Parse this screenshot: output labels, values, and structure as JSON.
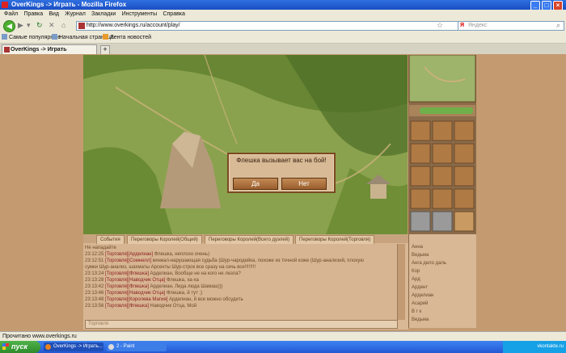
{
  "window": {
    "title": "OverKings -> Играть - Mozilla Firefox"
  },
  "menu": [
    "Файл",
    "Правка",
    "Вид",
    "Журнал",
    "Закладки",
    "Инструменты",
    "Справка"
  ],
  "nav": {
    "url": "http://www.overkings.ru/account/play/",
    "search_placeholder": "Яндекс",
    "search_logo": "Я"
  },
  "bookmarks": [
    "Самые популярные",
    "Начальная страница",
    "Лента новостей"
  ],
  "tab": {
    "label": "OverKings -> Играть",
    "new_tab": "+"
  },
  "popup": {
    "message": "Флешка вызывает вас на бой!",
    "yes": "Да",
    "no": "Нет"
  },
  "chat": {
    "tabs": [
      "События",
      "Переговоры Королей(Общий)",
      "Переговоры Королей(Всего дуэлей)",
      "Переговоры Королей(Торговля)"
    ],
    "lines": [
      {
        "time": "Не нападайте",
        "name": "",
        "text": ""
      },
      {
        "time": "23:12:25",
        "name": "[Торговля][Арделиан]",
        "text": " Флешка, неплохо очень)"
      },
      {
        "time": "23:12:51",
        "name": "[Торговля][Сомнелл]",
        "text": " кинжал-нарушающая судьба (Шур-чародейка, похоже из точной коже (Шур-анализий, плохую"
      },
      {
        "time": "",
        "name": "",
        "text": "сумки Шур-анализ, шахматы Арсенты Шур-строк все сразу на сечь все!!!!!!!!"
      },
      {
        "time": "23:13:24",
        "name": "[Торговля][Флешка]",
        "text": " Арделиан, Вообще не на кого не лезла?"
      },
      {
        "time": "23:13:28",
        "name": "[Торговля][Наводчик Отца]",
        "text": " Флешка, ха-ха"
      },
      {
        "time": "23:13:42",
        "name": "[Торговля][Флешка]",
        "text": " Арделиан, Лида люда Шамаш)))"
      },
      {
        "time": "23:13:46",
        "name": "[Торговля][Наводчик Отца]",
        "text": " Флешка, й тут ;)"
      },
      {
        "time": "23:13:48",
        "name": "[Торговля][Королева Магия]",
        "text": " Арделиан, й все можно обсудить"
      },
      {
        "time": "23:13:56",
        "name": "[Торговля][Флешка]",
        "text": " Наводчик Отца, Мой"
      }
    ],
    "input_placeholder": "Торговля"
  },
  "users": [
    "Анна",
    "Ведьма",
    "Анга дело даль",
    "Кор",
    "Ард",
    "Ардент",
    "Арделиан",
    "Асарий",
    "В г к",
    "Ведьма"
  ],
  "status": {
    "text": "Прочитано www.overkings.ru"
  },
  "taskbar": {
    "start": "пуск",
    "tasks": [
      "OverKings -> Играть...",
      "2 - Paint"
    ],
    "tray": "vkontakte.ru"
  }
}
